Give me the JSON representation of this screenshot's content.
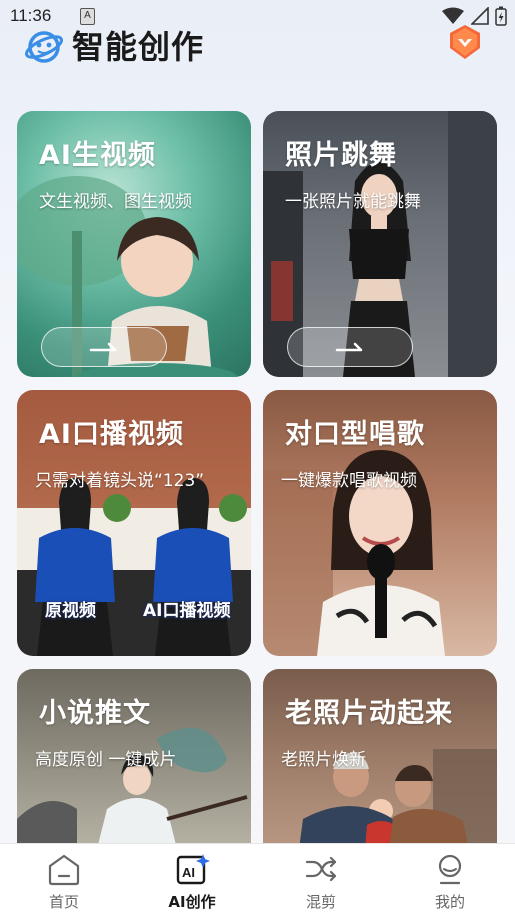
{
  "status": {
    "time": "11:36",
    "indicator": "A"
  },
  "header": {
    "title": "智能创作"
  },
  "cards": [
    {
      "title": "AI生视频",
      "subtitle": "文生视频、图生视频",
      "action": "arrow-right"
    },
    {
      "title": "照片跳舞",
      "subtitle": "一张照片就能跳舞",
      "action": "arrow-right"
    },
    {
      "title": "AI口播视频",
      "subtitle": "只需对着镜头说“123”",
      "labels": [
        "原视频",
        "AI口播视频"
      ]
    },
    {
      "title": "对口型唱歌",
      "subtitle": "一键爆款唱歌视频"
    },
    {
      "title": "小说推文",
      "subtitle": "高度原创 一键成片"
    },
    {
      "title": "老照片动起来",
      "subtitle": "老照片焕新"
    }
  ],
  "tabs": [
    {
      "label": "首页",
      "icon": "home-icon"
    },
    {
      "label": "AI创作",
      "icon": "ai-create-icon",
      "active": true
    },
    {
      "label": "混剪",
      "icon": "shuffle-icon"
    },
    {
      "label": "我的",
      "icon": "profile-icon"
    }
  ],
  "colors": {
    "accent_badge": "#f4683a",
    "logo_blue": "#3a8ee6",
    "active_tab": "#1a1a1a"
  }
}
